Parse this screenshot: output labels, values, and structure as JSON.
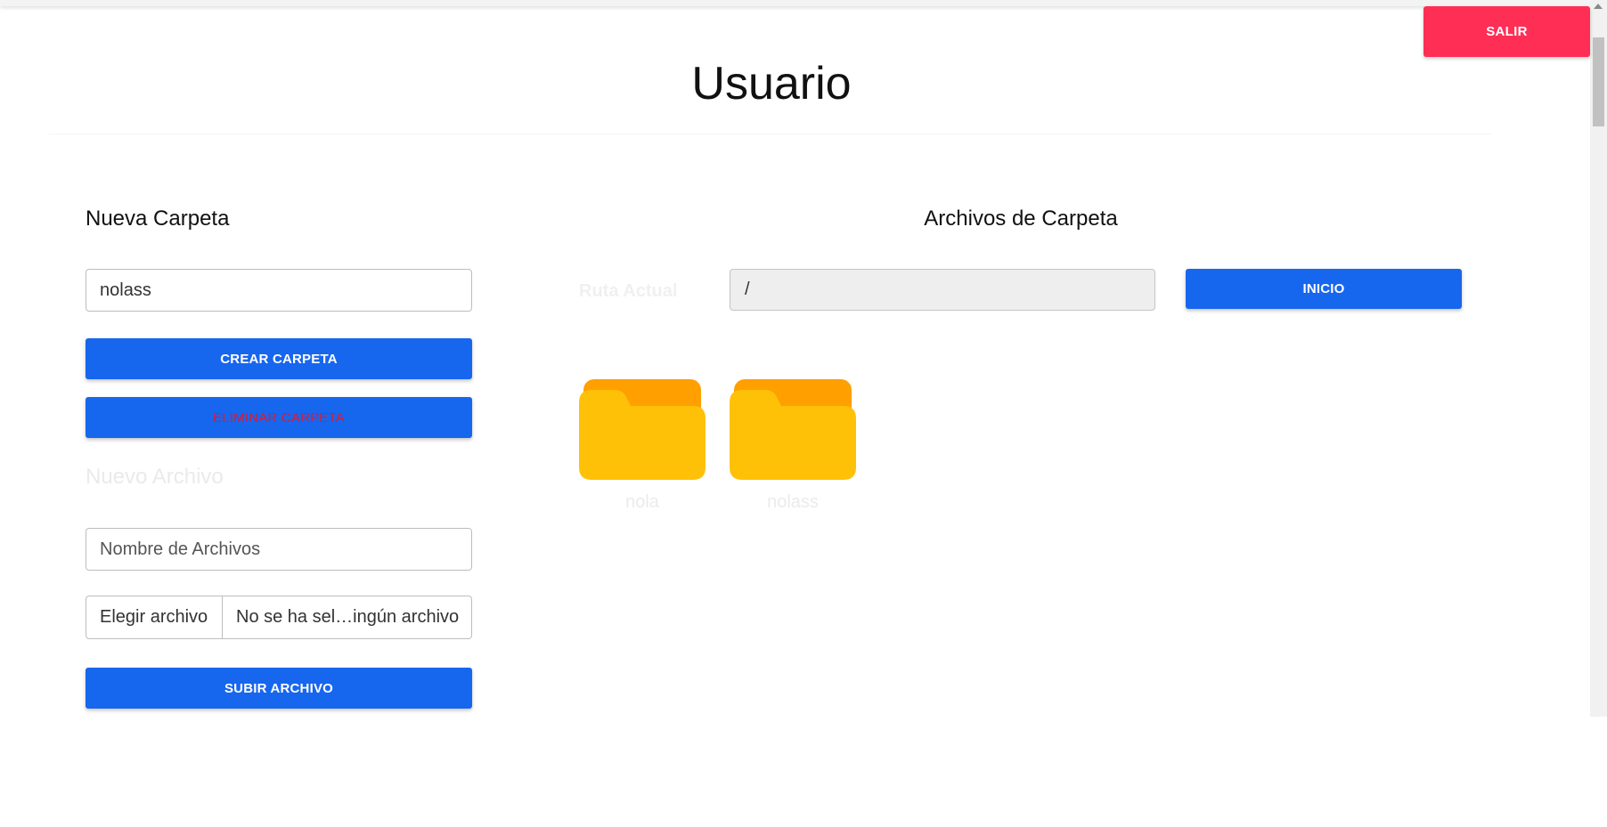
{
  "header": {
    "logout_label": "SALIR",
    "title": "Usuario"
  },
  "colors": {
    "primary": "#1766ee",
    "danger": "#ff2e55",
    "folder_front": "#ffc107",
    "folder_back": "#ff9f00"
  },
  "left_panel": {
    "new_folder_heading": "Nueva Carpeta",
    "folder_name_value": "nolass",
    "create_folder_label": "CREAR CARPETA",
    "delete_folder_label": "ELIMINAR CARPETA",
    "new_file_heading": "Nuevo Archivo",
    "file_name_placeholder": "Nombre de Archivos",
    "file_chooser": {
      "button_label": "Elegir archivo",
      "status_text": "No se ha sel…ingún archivo"
    },
    "upload_label": "SUBIR ARCHIVO"
  },
  "right_panel": {
    "heading": "Archivos de Carpeta",
    "path_label": "Ruta Actual",
    "path_value": "/",
    "home_label": "INICIO",
    "folders": [
      {
        "name": "nola",
        "icon": "folder-icon"
      },
      {
        "name": "nolass",
        "icon": "folder-icon"
      }
    ]
  }
}
